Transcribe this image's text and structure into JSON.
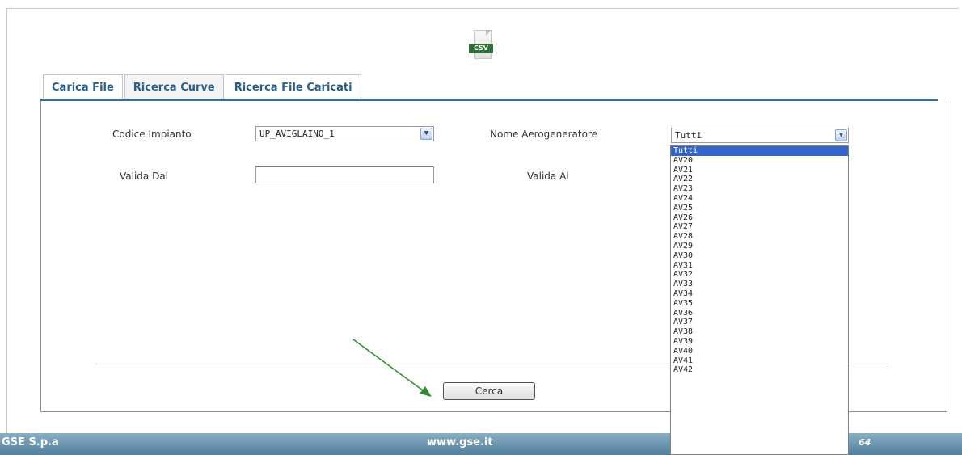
{
  "file_icon": {
    "icon": "csv-file-icon",
    "label": "CSV"
  },
  "tabs": [
    {
      "label": "Carica File",
      "active": false
    },
    {
      "label": "Ricerca Curve",
      "active": true
    },
    {
      "label": "Ricerca File Caricati",
      "active": false
    }
  ],
  "form": {
    "codice_impianto": {
      "label": "Codice Impianto",
      "value": "UP_AVIGLAINO_1"
    },
    "nome_aerogeneratore": {
      "label": "Nome Aerogeneratore",
      "value": "Tutti"
    },
    "valida_dal": {
      "label": "Valida Dal",
      "value": ""
    },
    "valida_al": {
      "label": "Valida Al",
      "value": ""
    }
  },
  "dropdown_options": [
    "Tutti",
    "AV20",
    "AV21",
    "AV22",
    "AV23",
    "AV24",
    "AV25",
    "AV26",
    "AV27",
    "AV28",
    "AV29",
    "AV30",
    "AV31",
    "AV32",
    "AV33",
    "AV34",
    "AV35",
    "AV36",
    "AV37",
    "AV38",
    "AV39",
    "AV40",
    "AV41",
    "AV42"
  ],
  "dropdown_selected": "Tutti",
  "search_button": {
    "label": "Cerca"
  },
  "footer": {
    "left": "GSE S.p.a",
    "center": "www.gse.it",
    "right": "64"
  },
  "colors": {
    "tab_text": "#2b5f86",
    "tab_rule": "#3a6e96",
    "selection": "#3465c9",
    "arrow": "#2e8b2e",
    "footer": "#5f8dab"
  }
}
